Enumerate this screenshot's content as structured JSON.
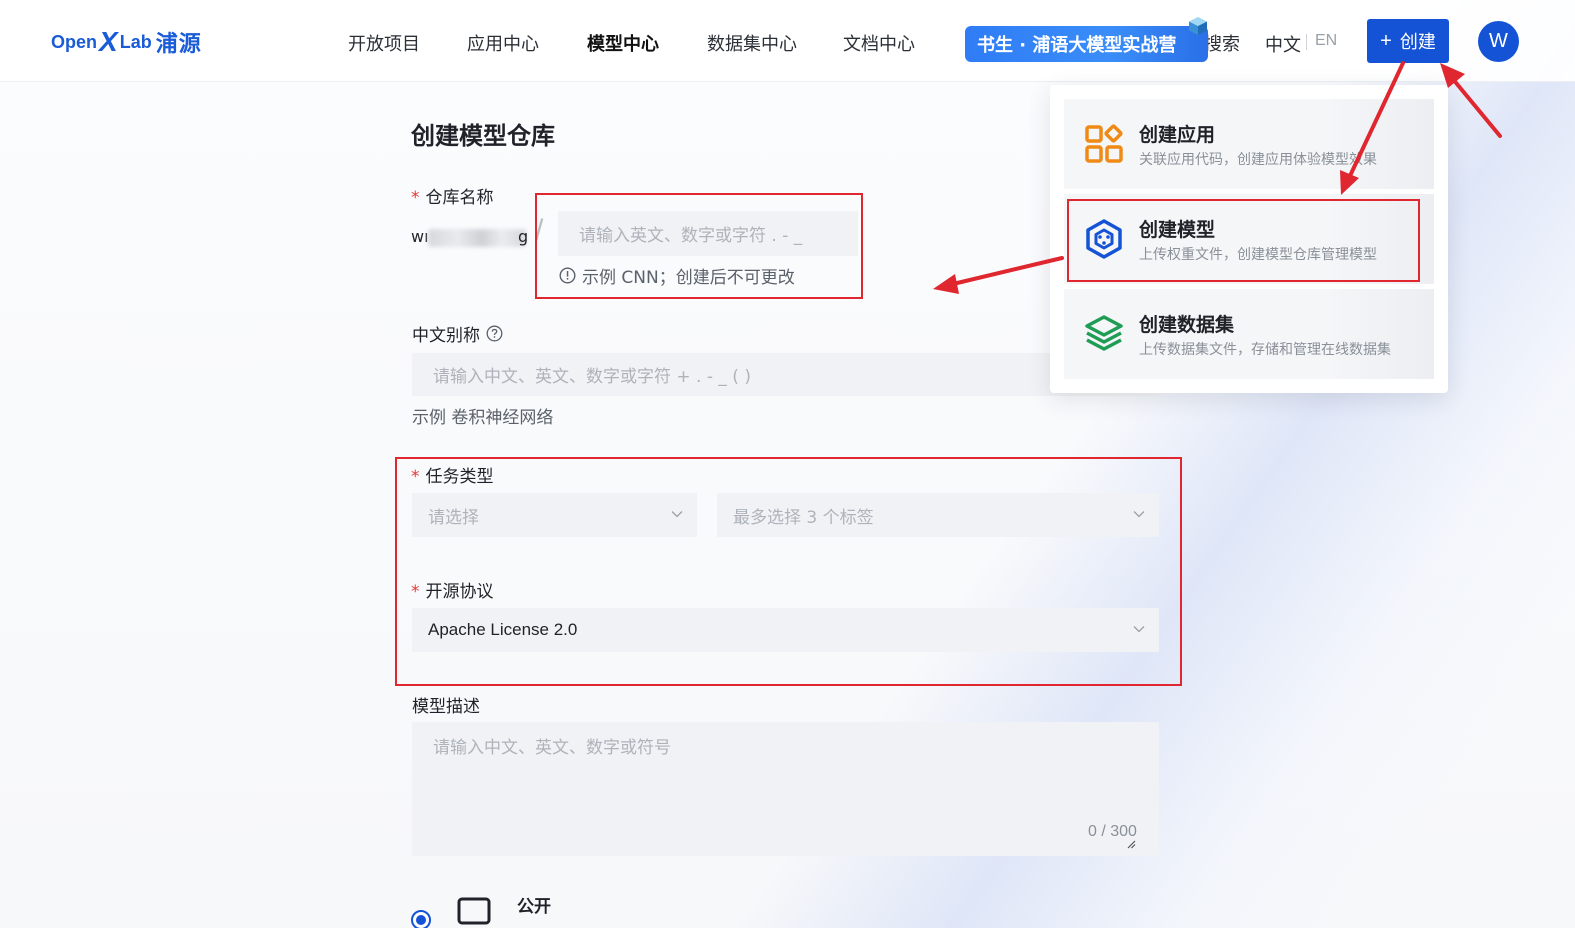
{
  "header": {
    "logo": {
      "open": "Open",
      "x": "X",
      "lab": "Lab",
      "cn": "浦源"
    },
    "nav": [
      {
        "label": "开放项目"
      },
      {
        "label": "应用中心"
      },
      {
        "label": "模型中心"
      },
      {
        "label": "数据集中心"
      },
      {
        "label": "文档中心"
      }
    ],
    "promo": "书生 · 浦语大模型实战营",
    "search": "搜索",
    "lang_zh": "中文",
    "lang_en": "EN",
    "create_label": "创建",
    "create_plus": "+",
    "avatar": "W"
  },
  "form": {
    "title": "创建模型仓库",
    "repo_name": {
      "label": "仓库名称",
      "owner_prefix": "wı",
      "owner_suffix": "g",
      "slash": "/",
      "placeholder": "请输入英文、数字或字符 . - _",
      "hint": "示例 CNN；创建后不可更改"
    },
    "alias": {
      "label": "中文别称",
      "placeholder": "请输入中文、英文、数字或字符 + . - _ ( )",
      "hint": "示例 卷积神经网络"
    },
    "task": {
      "label": "任务类型",
      "placeholder": "请选择",
      "tags_placeholder": "最多选择 3 个标签"
    },
    "license": {
      "label": "开源协议",
      "value": "Apache License 2.0"
    },
    "description": {
      "label": "模型描述",
      "placeholder": "请输入中文、英文、数字或符号",
      "counter": "0 / 300"
    },
    "visibility": {
      "label": "公开"
    },
    "required_mark": "*"
  },
  "dropdown": {
    "items": [
      {
        "title": "创建应用",
        "desc": "关联应用代码，创建应用体验模型效果",
        "icon": "apps-grid-icon",
        "color": "#f08a16"
      },
      {
        "title": "创建模型",
        "desc": "上传权重文件，创建模型仓库管理模型",
        "icon": "model-cube-icon",
        "color": "#1553d6"
      },
      {
        "title": "创建数据集",
        "desc": "上传数据集文件，存储和管理在线数据集",
        "icon": "dataset-layers-icon",
        "color": "#1f9d55"
      }
    ]
  },
  "colors": {
    "brand": "#1553d6",
    "annotation": "#e0262f",
    "required": "#e53935"
  }
}
